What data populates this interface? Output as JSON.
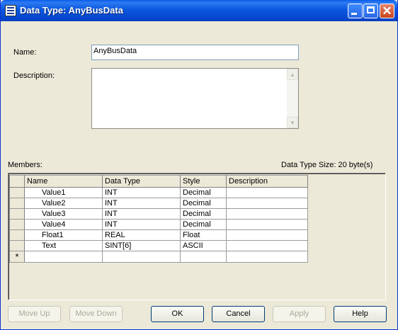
{
  "window": {
    "title": "Data Type:  AnyBusData"
  },
  "form": {
    "name_label": "Name:",
    "name_value": "AnyBusData",
    "description_label": "Description:",
    "description_value": "",
    "members_label": "Members:",
    "size_label": "Data Type Size: 20 byte(s)"
  },
  "table": {
    "columns": [
      "Name",
      "Data Type",
      "Style",
      "Description"
    ],
    "rows": [
      {
        "name": "Value1",
        "type": "INT",
        "style": "Decimal",
        "description": ""
      },
      {
        "name": "Value2",
        "type": "INT",
        "style": "Decimal",
        "description": ""
      },
      {
        "name": "Value3",
        "type": "INT",
        "style": "Decimal",
        "description": ""
      },
      {
        "name": "Value4",
        "type": "INT",
        "style": "Decimal",
        "description": ""
      },
      {
        "name": "Float1",
        "type": "REAL",
        "style": "Float",
        "description": ""
      },
      {
        "name": "Text",
        "type": "SINT[6]",
        "style": "ASCII",
        "description": ""
      }
    ],
    "new_row_marker": "*"
  },
  "buttons": {
    "move_up": "Move Up",
    "move_down": "Move Down",
    "ok": "OK",
    "cancel": "Cancel",
    "apply": "Apply",
    "help": "Help"
  }
}
